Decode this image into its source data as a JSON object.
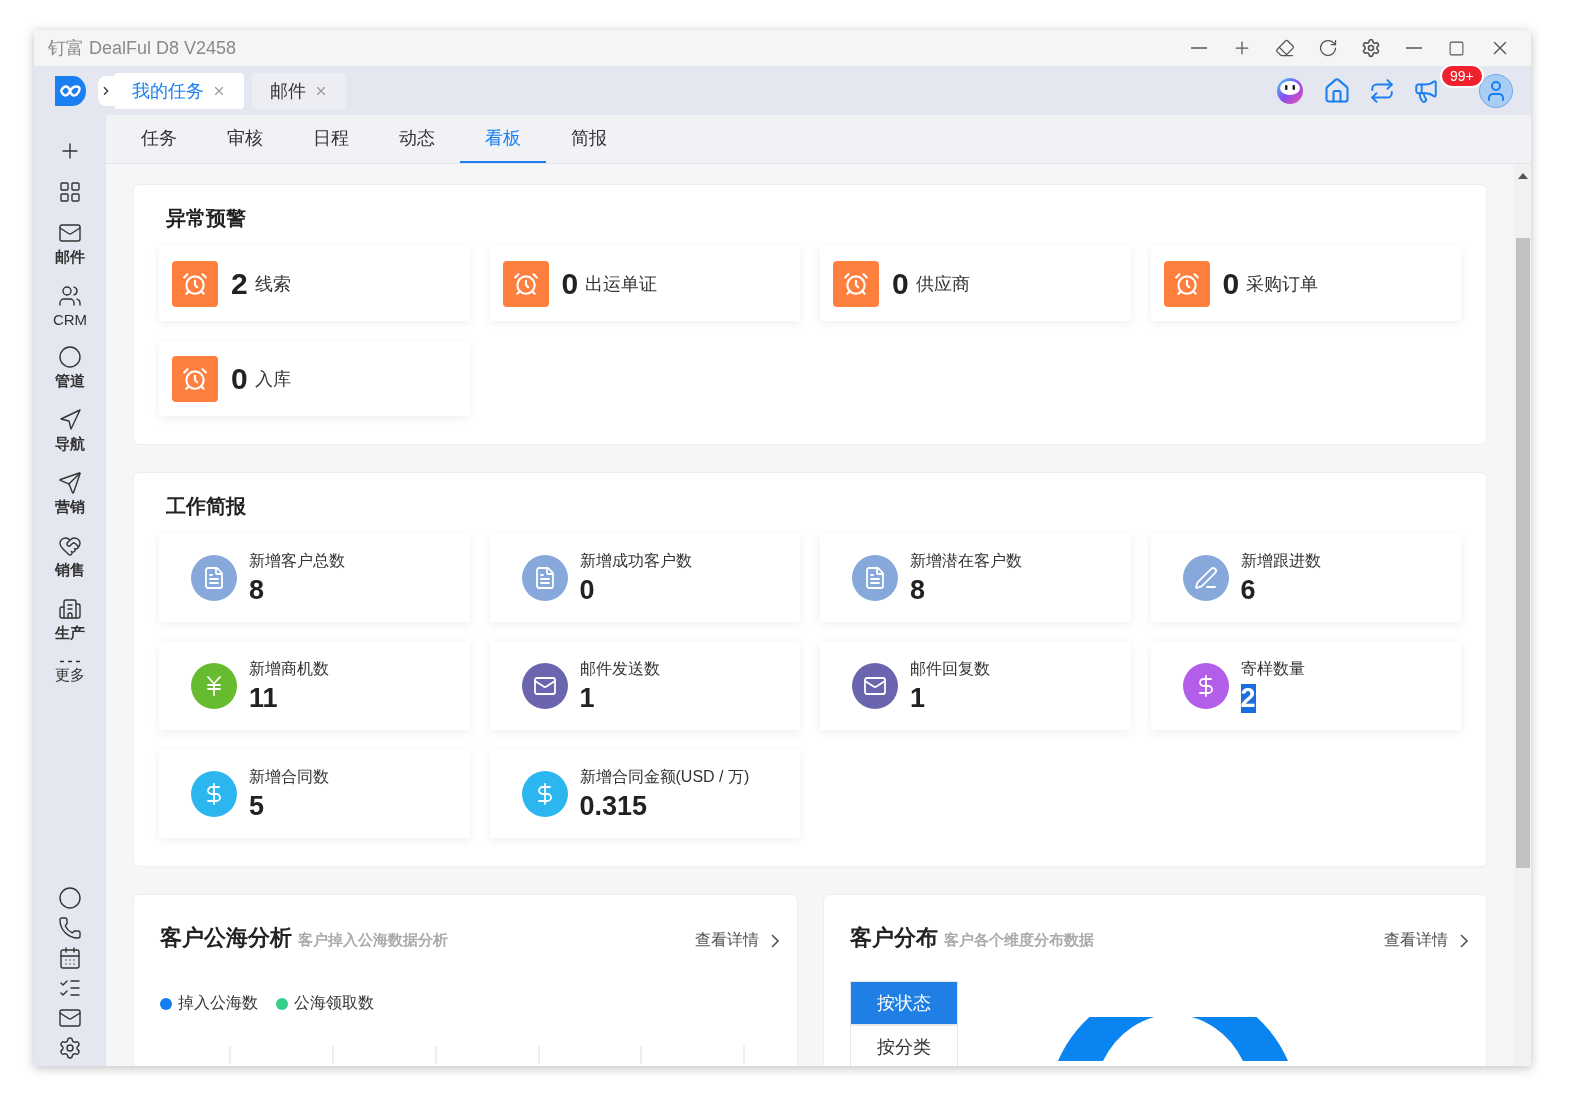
{
  "window": {
    "title": "钉富 DealFul D8 V2458"
  },
  "open_tabs": [
    {
      "label": "我的任务",
      "selected": true
    },
    {
      "label": "邮件",
      "selected": false
    }
  ],
  "notifications": {
    "badge": "99+"
  },
  "sidebar": {
    "items": [
      {
        "kind": "plus"
      },
      {
        "kind": "grid"
      },
      {
        "kind": "mail",
        "label": "邮件",
        "bold": true
      },
      {
        "kind": "users",
        "label": "CRM",
        "bold": false
      },
      {
        "kind": "ring",
        "label": "管道",
        "bold": true
      },
      {
        "kind": "nav",
        "label": "导航",
        "bold": true
      },
      {
        "kind": "send",
        "label": "营销",
        "bold": true
      },
      {
        "kind": "heart",
        "label": "销售",
        "bold": true
      },
      {
        "kind": "building",
        "label": "生产",
        "bold": true
      },
      {
        "kind": "dots",
        "label": "更多",
        "bold": false
      }
    ],
    "bottom": [
      {
        "kind": "ring"
      },
      {
        "kind": "phone"
      },
      {
        "kind": "calendar"
      },
      {
        "kind": "list"
      },
      {
        "kind": "mail"
      },
      {
        "kind": "gear"
      }
    ]
  },
  "sub_tabs": [
    {
      "label": "任务",
      "selected": false
    },
    {
      "label": "审核",
      "selected": false
    },
    {
      "label": "日程",
      "selected": false
    },
    {
      "label": "动态",
      "selected": false
    },
    {
      "label": "看板",
      "selected": true
    },
    {
      "label": "简报",
      "selected": false
    }
  ],
  "alerts": {
    "title": "异常预警",
    "items": [
      {
        "count": "2",
        "label": "线索"
      },
      {
        "count": "0",
        "label": "出运单证"
      },
      {
        "count": "0",
        "label": "供应商"
      },
      {
        "count": "0",
        "label": "采购订单"
      },
      {
        "count": "0",
        "label": "入库"
      }
    ]
  },
  "briefing": {
    "title": "工作简报",
    "items": [
      {
        "label": "新增客户总数",
        "value": "8",
        "kind": "document",
        "color": "#86a8da",
        "highlighted": false
      },
      {
        "label": "新增成功客户数",
        "value": "0",
        "kind": "document",
        "color": "#86a8da",
        "highlighted": false
      },
      {
        "label": "新增潜在客户数",
        "value": "8",
        "kind": "document",
        "color": "#86a8da",
        "highlighted": false
      },
      {
        "label": "新增跟进数",
        "value": "6",
        "kind": "pen",
        "color": "#86a8da",
        "highlighted": false
      },
      {
        "label": "新增商机数",
        "value": "11",
        "kind": "yen",
        "color": "#67bb2f",
        "highlighted": false
      },
      {
        "label": "邮件发送数",
        "value": "1",
        "kind": "mail",
        "color": "#6a65ae",
        "highlighted": false
      },
      {
        "label": "邮件回复数",
        "value": "1",
        "kind": "mail",
        "color": "#6a65ae",
        "highlighted": false
      },
      {
        "label": "寄样数量",
        "value": "2",
        "kind": "dollar",
        "color": "#b25ee8",
        "highlighted": true
      },
      {
        "label": "新增合同数",
        "value": "5",
        "kind": "dollar",
        "color": "#2bb6f0",
        "highlighted": false
      },
      {
        "label": "新增合同金额(USD / 万)",
        "value": "0.315",
        "kind": "dollar",
        "color": "#2bb6f0",
        "highlighted": false
      }
    ]
  },
  "sea_analysis": {
    "title": "客户公海分析",
    "subtitle": "客户掉入公海数据分析",
    "link": "查看详情",
    "legend": [
      {
        "label": "掉入公海数",
        "color": "#1480f0"
      },
      {
        "label": "公海领取数",
        "color": "#36cf8a"
      }
    ]
  },
  "distribution": {
    "title": "客户分布",
    "subtitle": "客户各个维度分布数据",
    "link": "查看详情",
    "modes": [
      {
        "label": "按状态",
        "selected": true
      },
      {
        "label": "按分类",
        "selected": false
      }
    ]
  }
}
